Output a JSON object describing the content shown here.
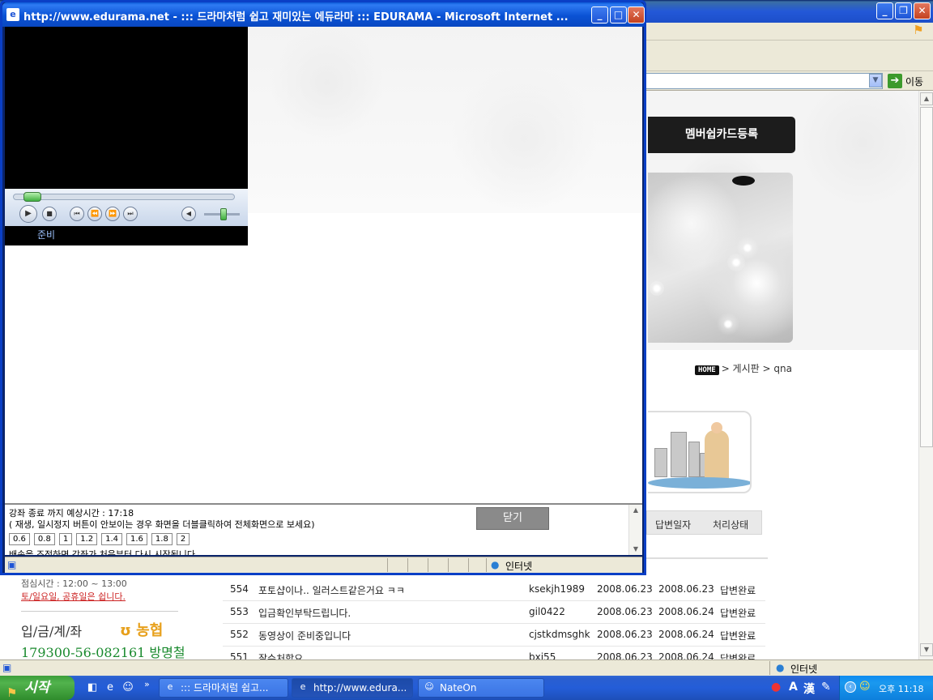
{
  "background_window": {
    "address_go_label": "이동",
    "member_card_button": "멤버쉽카드등록",
    "breadcrumb": {
      "home": "HOME",
      "path": "> 게시판 > qna"
    },
    "board_header": {
      "answer_date": "답변일자",
      "status": "처리상태"
    },
    "board_rows": [
      {
        "no": "554",
        "title": "포토샵이나.. 일러스트같은거요 ㅋㅋ",
        "id": "ksekjh1989",
        "date": "2008.06.23",
        "answer_date": "2008.06.23",
        "status": "답변완료"
      },
      {
        "no": "553",
        "title": "입금확인부탁드립니다.",
        "id": "gil0422",
        "date": "2008.06.23",
        "answer_date": "2008.06.24",
        "status": "답변완료"
      },
      {
        "no": "552",
        "title": "동영상이 준비중입니다",
        "id": "cjstkdmsghk",
        "date": "2008.06.23",
        "answer_date": "2008.06.24",
        "status": "답변완료"
      },
      {
        "no": "551",
        "title": "잘수처합요",
        "id": "bxi55",
        "date": "2008.06.23",
        "answer_date": "2008.06.24",
        "status": "답변완료"
      }
    ],
    "left_info": {
      "lunch_time": "점심시간 : 12:00 ~ 13:00",
      "holiday_note": "토/일요일, 공휴일은 쉽니다.",
      "deposit_label": "입/금/계/좌",
      "bank_logo": "농협",
      "account_number": "179300-56-082161 방명철"
    },
    "status_zone": "인터넷"
  },
  "popup": {
    "title": "http://www.edurama.net - ::: 드라마처럼 쉽고 재미있는 에듀라마 ::: EDURAMA - Microsoft Internet ...",
    "player": {
      "status": "준비",
      "seek_fraction": 0.05,
      "volume_fraction": 0.55
    },
    "remaining_time": "강좌 종료 까지 예상시간 : 17:18",
    "fullscreen_hint": "( 재생, 일시정지 버튼이 안보이는 경우 화면을 더블클릭하여 전체화면으로 보세요)",
    "close_button": "닫기",
    "speed_options": [
      "0.6",
      "0.8",
      "1",
      "1.2",
      "1.4",
      "1.6",
      "1.8",
      "2"
    ],
    "speed_note": "배속을 조정하면 강좌가 처음부터 다시 시작됩니다.",
    "status_zone": "인터넷"
  },
  "taskbar": {
    "start_label": "시작",
    "tasks": [
      {
        "label": "::: 드라마처럼 쉽고...",
        "icon": "ie-icon"
      },
      {
        "label": "http://www.edura...",
        "icon": "ie-icon"
      },
      {
        "label": "NateOn",
        "icon": "nateon-icon"
      }
    ],
    "ime": {
      "lang": "A",
      "hanja": "漢"
    },
    "clock": "오후 11:18"
  }
}
